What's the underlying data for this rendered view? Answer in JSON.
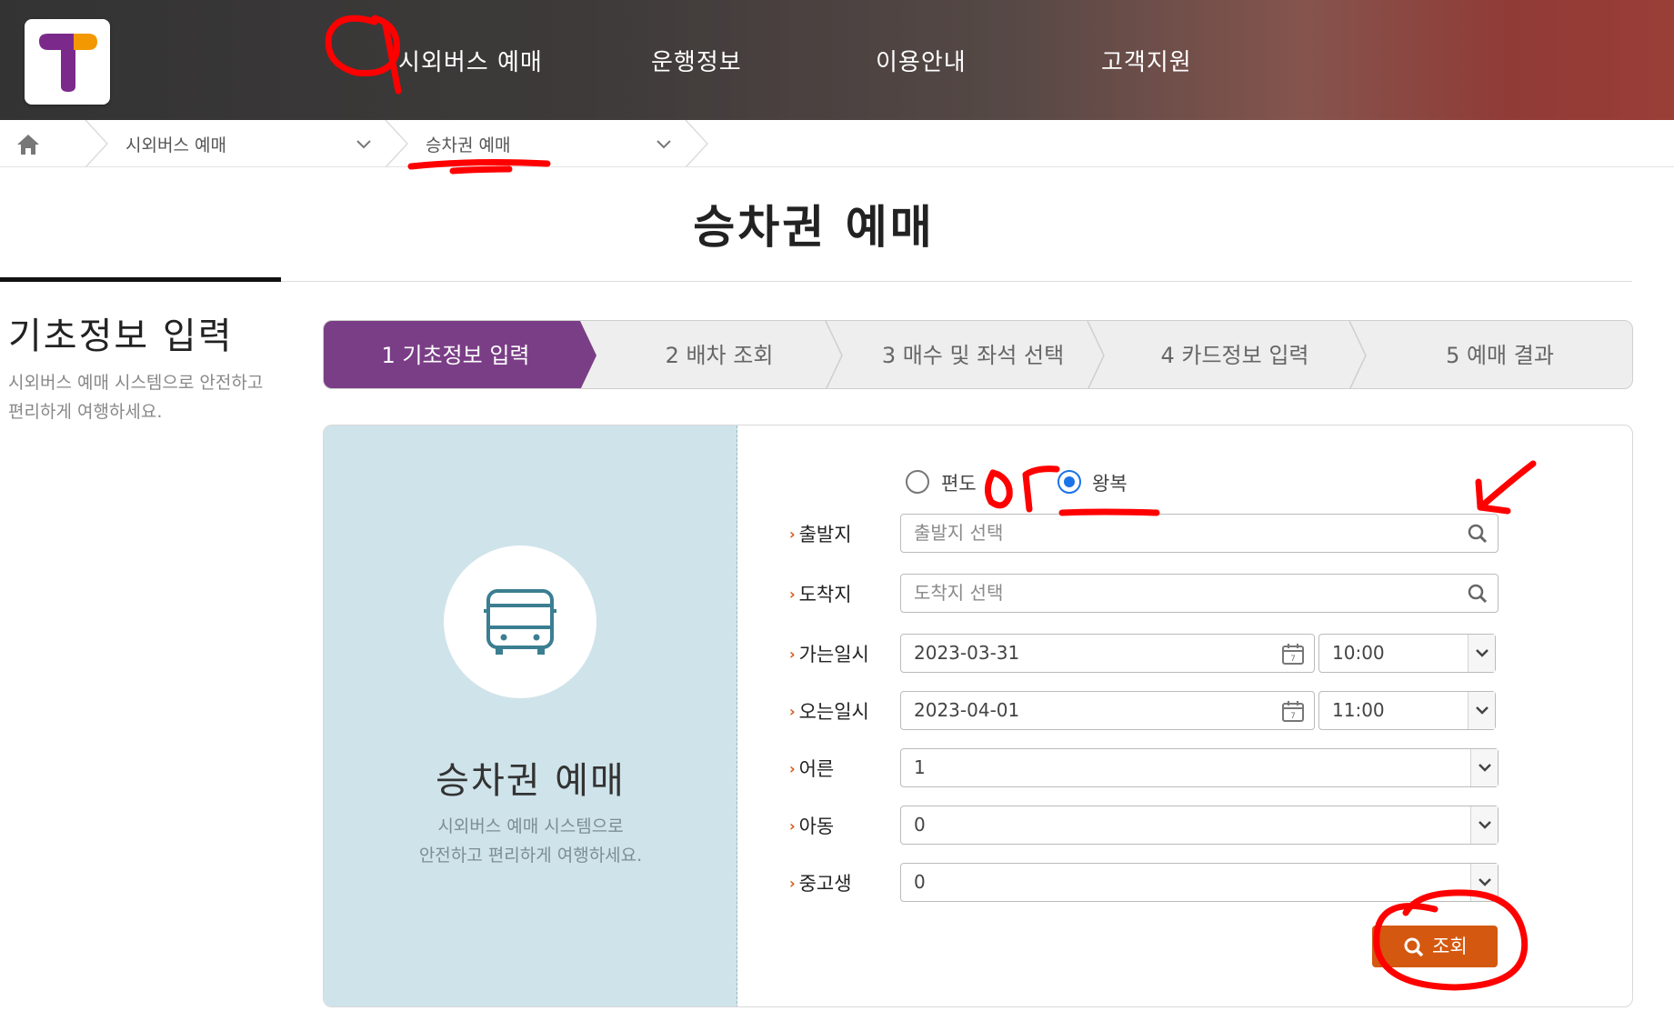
{
  "header": {
    "logo_icon": "tago-t-logo",
    "brand_colors": {
      "purple": "#7b2a8b",
      "orange": "#f39800"
    },
    "nav": [
      {
        "label": "시외버스 예매"
      },
      {
        "label": "운행정보"
      },
      {
        "label": "이용안내"
      },
      {
        "label": "고객지원"
      }
    ]
  },
  "breadcrumb": {
    "home_icon": "home-icon",
    "items": [
      {
        "label": "시외버스 예매"
      },
      {
        "label": "승차권 예매"
      }
    ]
  },
  "page": {
    "title": "승차권 예매"
  },
  "side": {
    "title": "기초정보 입력",
    "description": "시외버스 예매 시스템으로 안전하고 편리하게 여행하세요."
  },
  "steps": [
    {
      "label": "1 기초정보 입력",
      "active": true
    },
    {
      "label": "2 배차 조회",
      "active": false
    },
    {
      "label": "3 매수 및 좌석 선택",
      "active": false
    },
    {
      "label": "4 카드정보 입력",
      "active": false
    },
    {
      "label": "5 예매 결과",
      "active": false
    }
  ],
  "panel": {
    "bus_icon": "bus-icon",
    "title": "승차권 예매",
    "description_line1": "시외버스 예매 시스템으로",
    "description_line2": "안전하고 편리하게 여행하세요."
  },
  "form": {
    "trip_type": {
      "options": [
        "편도",
        "왕복"
      ],
      "selected": "왕복"
    },
    "departure": {
      "label": "출발지",
      "placeholder": "출발지 선택",
      "value": ""
    },
    "arrival": {
      "label": "도착지",
      "placeholder": "도착지 선택",
      "value": ""
    },
    "go_date": {
      "label": "가는일시",
      "date": "2023-03-31",
      "time": "10:00"
    },
    "return_date": {
      "label": "오는일시",
      "date": "2023-04-01",
      "time": "11:00"
    },
    "adult": {
      "label": "어른",
      "value": "1"
    },
    "child": {
      "label": "아동",
      "value": "0"
    },
    "student": {
      "label": "중고생",
      "value": "0"
    },
    "search_button": {
      "label": "조회",
      "color": "#d4580f"
    }
  },
  "accent_colors": {
    "step_active": "#7a3e86",
    "panel_left_bg": "#cfe3ea",
    "radio_checked": "#1a73e8",
    "annotation": "#ff0000"
  }
}
